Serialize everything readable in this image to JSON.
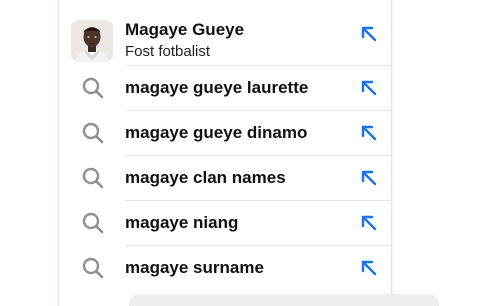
{
  "entity": {
    "title": "Magaye Gueye",
    "subtitle": "Fost fotbalist",
    "icon": "arrow-up-left-icon"
  },
  "suggestions": [
    {
      "label": "magaye gueye laurette",
      "icon": "search-icon",
      "action_icon": "arrow-up-left-icon"
    },
    {
      "label": "magaye gueye dinamo",
      "icon": "search-icon",
      "action_icon": "arrow-up-left-icon"
    },
    {
      "label": "magaye clan names",
      "icon": "search-icon",
      "action_icon": "arrow-up-left-icon"
    },
    {
      "label": "magaye niang",
      "icon": "search-icon",
      "action_icon": "arrow-up-left-icon"
    },
    {
      "label": "magaye surname",
      "icon": "search-icon",
      "action_icon": "arrow-up-left-icon"
    }
  ],
  "colors": {
    "accent": "#1a73e8",
    "search_icon": "#8e8e93",
    "text": "#111111"
  }
}
